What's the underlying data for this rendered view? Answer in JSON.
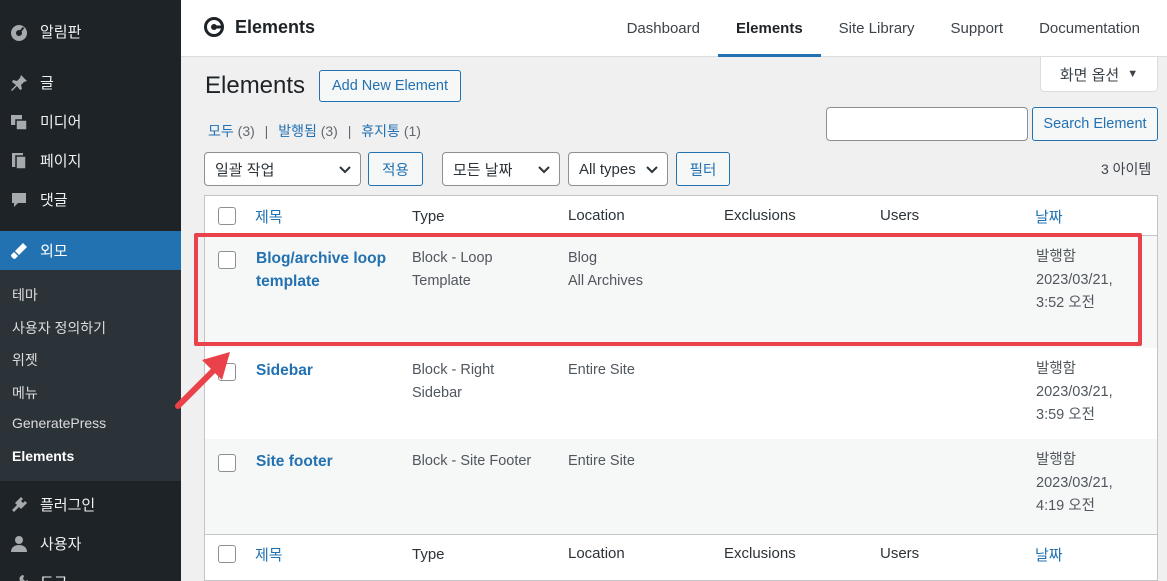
{
  "sidebar": {
    "items": [
      {
        "label": "알림판",
        "icon": "dashboard-icon"
      },
      {
        "label": "글",
        "icon": "pin-icon"
      },
      {
        "label": "미디어",
        "icon": "media-icon"
      },
      {
        "label": "페이지",
        "icon": "pages-icon"
      },
      {
        "label": "댓글",
        "icon": "comments-icon"
      },
      {
        "label": "외모",
        "icon": "appearance-icon"
      }
    ],
    "submenu": [
      "테마",
      "사용자 정의하기",
      "위젯",
      "메뉴",
      "GeneratePress",
      "Elements"
    ],
    "items_after": [
      {
        "label": "플러그인",
        "icon": "plugins-icon"
      },
      {
        "label": "사용자",
        "icon": "users-icon"
      },
      {
        "label": "도구",
        "icon": "tools-icon"
      }
    ]
  },
  "header": {
    "brand": "Elements",
    "tabs": [
      "Dashboard",
      "Elements",
      "Site Library",
      "Support",
      "Documentation"
    ],
    "active_tab": "Elements"
  },
  "screen_options": "화면 옵션",
  "page": {
    "title": "Elements",
    "add_new": "Add New Element"
  },
  "views": {
    "all": "모두",
    "all_count": "(3)",
    "published": "발행됨",
    "published_count": "(3)",
    "trash": "휴지통",
    "trash_count": "(1)"
  },
  "search": {
    "value": "",
    "button": "Search Element"
  },
  "filters": {
    "bulk": "일괄 작업",
    "apply": "적용",
    "dates": "모든 날짜",
    "types": "All types",
    "filter": "필터"
  },
  "item_count": "3 아이템",
  "table": {
    "columns": [
      "제목",
      "Type",
      "Location",
      "Exclusions",
      "Users",
      "날짜"
    ],
    "rows": [
      {
        "title_line1": "Blog/archive loop",
        "title_line2": "template",
        "type1": "Block - Loop",
        "type2": "Template",
        "loc1": "Blog",
        "loc2": "All Archives",
        "status": "발행함",
        "date": "2023/03/21,",
        "time": "3:52 오전"
      },
      {
        "title_line1": "Sidebar",
        "title_line2": "",
        "type1": "Block - Right",
        "type2": "Sidebar",
        "loc1": "Entire Site",
        "loc2": "",
        "status": "발행함",
        "date": "2023/03/21,",
        "time": "3:59 오전"
      },
      {
        "title_line1": "Site footer",
        "title_line2": "",
        "type1": "Block - Site Footer",
        "type2": "",
        "loc1": "Entire Site",
        "loc2": "",
        "status": "발행함",
        "date": "2023/03/21,",
        "time": "4:19 오전"
      }
    ]
  },
  "colors": {
    "accent": "#2271b1",
    "sidebar": "#1d2327",
    "highlight": "#e9424a"
  }
}
